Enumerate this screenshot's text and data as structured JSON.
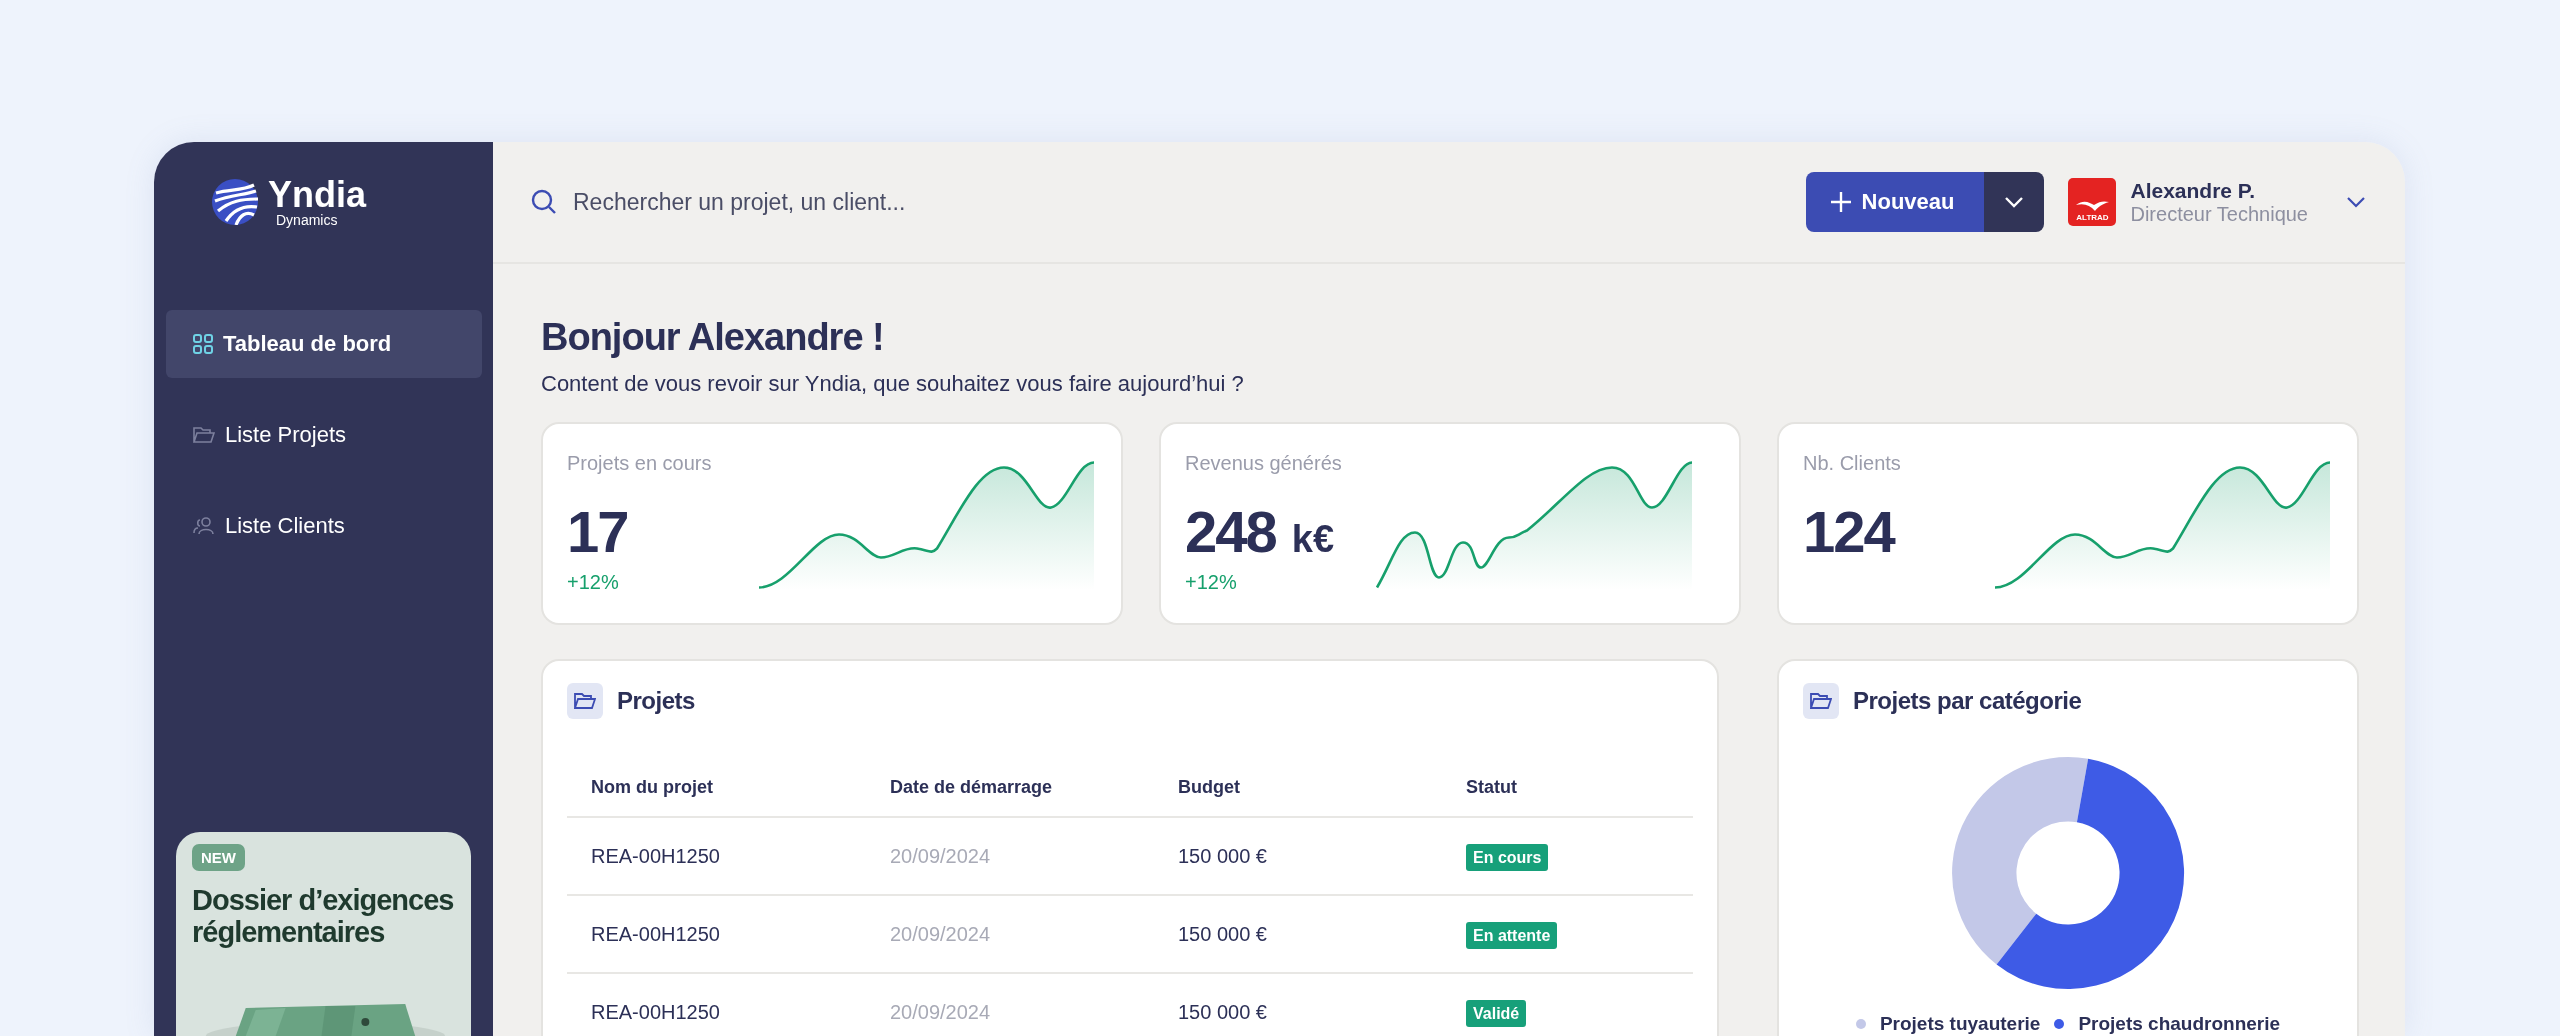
{
  "sidebar": {
    "logo": {
      "name": "Yndia",
      "tagline": "Dynamics"
    },
    "items": [
      {
        "label": "Tableau de bord",
        "selected": true
      },
      {
        "label": "Liste Projets",
        "selected": false
      },
      {
        "label": "Liste Clients",
        "selected": false
      }
    ],
    "promo": {
      "badge": "NEW",
      "title": "Dossier d’exigences réglementaires"
    }
  },
  "topbar": {
    "search": {
      "placeholder": "Rechercher un projet, un client..."
    },
    "new_button": "Nouveau",
    "user": {
      "company": "ALTRAD",
      "name": "Alexandre P.",
      "role": "Directeur Technique"
    }
  },
  "greeting": {
    "title": "Bonjour Alexandre !",
    "subtitle": "Content de vous revoir sur Yndia, que souhaitez vous faire aujourd’hui ?"
  },
  "stats": [
    {
      "label": "Projets en cours",
      "value": "17",
      "trend": "+12%"
    },
    {
      "label": "Revenus générés",
      "value": "248",
      "unit": "k€",
      "trend": "+12%"
    },
    {
      "label": "Nb. Clients",
      "value": "124"
    }
  ],
  "projects": {
    "title": "Projets",
    "columns": [
      "Nom du projet",
      "Date de démarrage",
      "Budget",
      "Statut"
    ],
    "rows": [
      {
        "name": "REA-00H1250",
        "date": "20/09/2024",
        "budget": "150 000 €",
        "status": "En cours"
      },
      {
        "name": "REA-00H1250",
        "date": "20/09/2024",
        "budget": "150 000 €",
        "status": "En attente"
      },
      {
        "name": "REA-00H1250",
        "date": "20/09/2024",
        "budget": "150 000 €",
        "status": "Validé"
      }
    ]
  },
  "categories": {
    "title": "Projets par catégorie",
    "legend": [
      {
        "label": "Projets tuyauterie",
        "color": "#c3c8e8"
      },
      {
        "label": "Projets chaudronnerie",
        "color": "#3e5be6"
      }
    ]
  }
}
